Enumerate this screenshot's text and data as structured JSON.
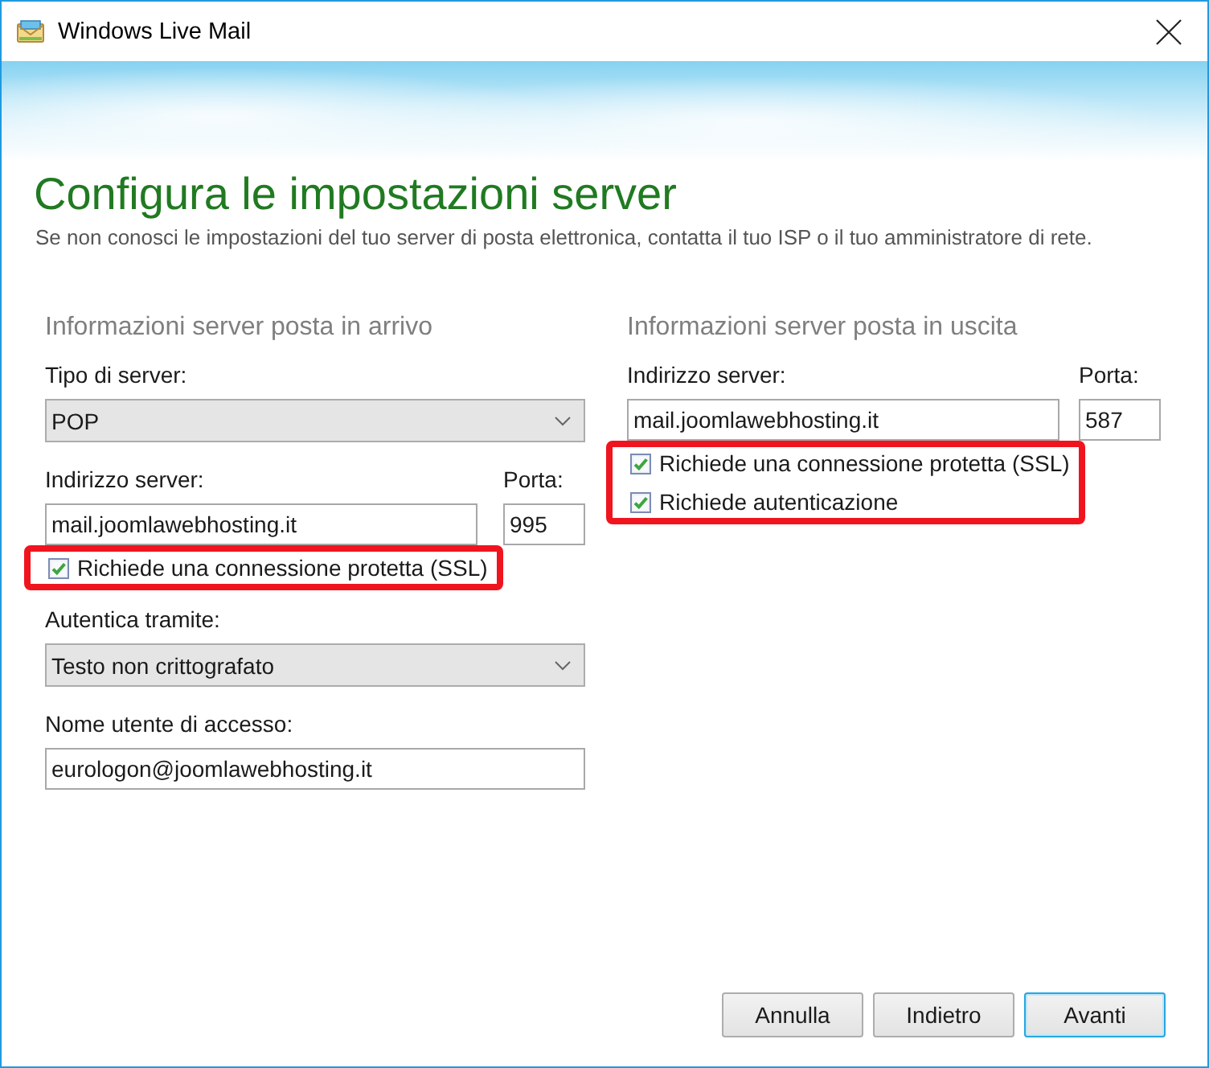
{
  "window": {
    "title": "Windows Live Mail"
  },
  "header": {
    "title": "Configura le impostazioni server",
    "subtitle": "Se non conosci le impostazioni del tuo server di posta elettronica, contatta il tuo ISP o il tuo amministratore di rete."
  },
  "columns": [
    {
      "heading": "Informazioni server posta in arrivo",
      "fields": [
        {
          "kind": "select",
          "label": "Tipo di server:",
          "value": "POP"
        },
        {
          "kind": "server",
          "label": "Indirizzo server:",
          "value": "mail.joomlawebhosting.it",
          "port_label": "Porta:",
          "port_value": "995"
        },
        {
          "kind": "checks",
          "highlighted": true,
          "items": [
            {
              "label": "Richiede una connessione protetta (SSL)",
              "checked": true
            }
          ]
        },
        {
          "kind": "select",
          "label": "Autentica tramite:",
          "value": "Testo non crittografato"
        },
        {
          "kind": "text",
          "label": "Nome utente di accesso:",
          "value": "eurologon@joomlawebhosting.it"
        }
      ]
    },
    {
      "heading": "Informazioni server posta in uscita",
      "fields": [
        {
          "kind": "server",
          "label": "Indirizzo server:",
          "value": "mail.joomlawebhosting.it",
          "port_label": "Porta:",
          "port_value": "587"
        },
        {
          "kind": "checks",
          "highlighted": true,
          "items": [
            {
              "label": "Richiede una connessione protetta (SSL)",
              "checked": true
            },
            {
              "label": "Richiede autenticazione",
              "checked": true
            }
          ]
        }
      ]
    }
  ],
  "buttons": [
    {
      "label": "Annulla",
      "focused": false
    },
    {
      "label": "Indietro",
      "focused": false
    },
    {
      "label": "Avanti",
      "focused": true
    }
  ]
}
